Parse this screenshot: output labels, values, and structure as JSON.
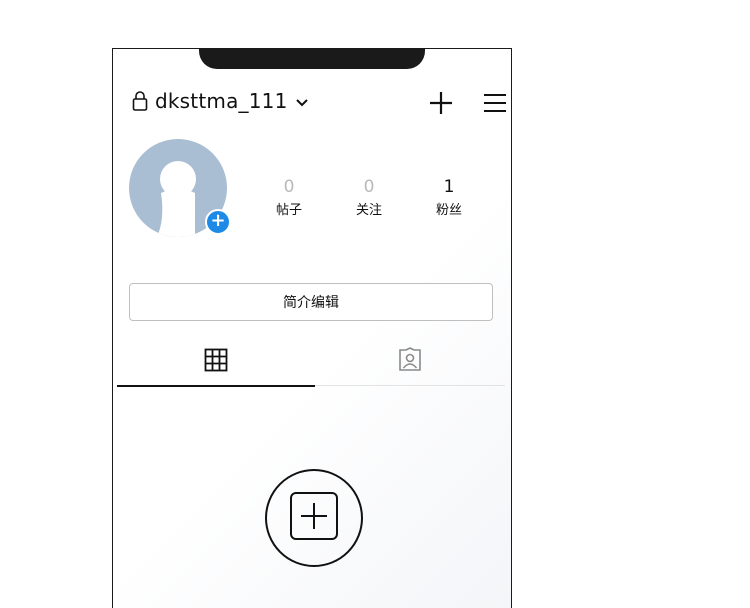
{
  "header": {
    "username": "dksttma_111"
  },
  "stats": [
    {
      "value": "0",
      "label": "帖子"
    },
    {
      "value": "0",
      "label": "关注"
    },
    {
      "value": "1",
      "label": "粉丝"
    }
  ],
  "profile": {
    "edit_button_label": "简介编辑"
  },
  "tabs": [
    {
      "icon": "grid-icon",
      "active": true
    },
    {
      "icon": "tagged-icon",
      "active": false
    }
  ],
  "colors": {
    "accent": "#1d8ae8",
    "avatar_bg": "#a9bed3",
    "muted_text": "#b9b9b9"
  }
}
